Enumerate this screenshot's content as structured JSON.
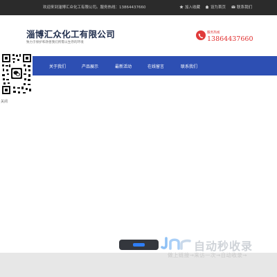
{
  "topbar": {
    "welcome": "欢迎来到淄博汇众化工有限公司。服务热线：13864437660",
    "links": [
      {
        "label": "加入收藏",
        "icon": "star-icon"
      },
      {
        "label": "设为首页",
        "icon": "home-icon"
      },
      {
        "label": "联系我们",
        "icon": "mail-icon"
      }
    ]
  },
  "header": {
    "company_name": "淄博汇众化工有限公司",
    "slogan": "致力于保护和改善我们所需以生存的环境",
    "hotline_label": "服务热线",
    "hotline_number": "13864437660"
  },
  "nav": {
    "items": [
      {
        "label": "关于我们"
      },
      {
        "label": "产品展示"
      },
      {
        "label": "最新活动"
      },
      {
        "label": "在线留言"
      },
      {
        "label": "联系我们"
      }
    ]
  },
  "qr": {
    "close_label": "关闭"
  },
  "watermark": {
    "title": "自动秒收录",
    "subtitle": "做上链接→来访一次→自动收录→"
  },
  "colors": {
    "topbar_bg": "#2b2b2b",
    "nav_bg": "#2d4fb3",
    "brand_text": "#1f2d4c",
    "hotline_red": "#e02a2a",
    "footer_bg": "#e7e7e7"
  }
}
